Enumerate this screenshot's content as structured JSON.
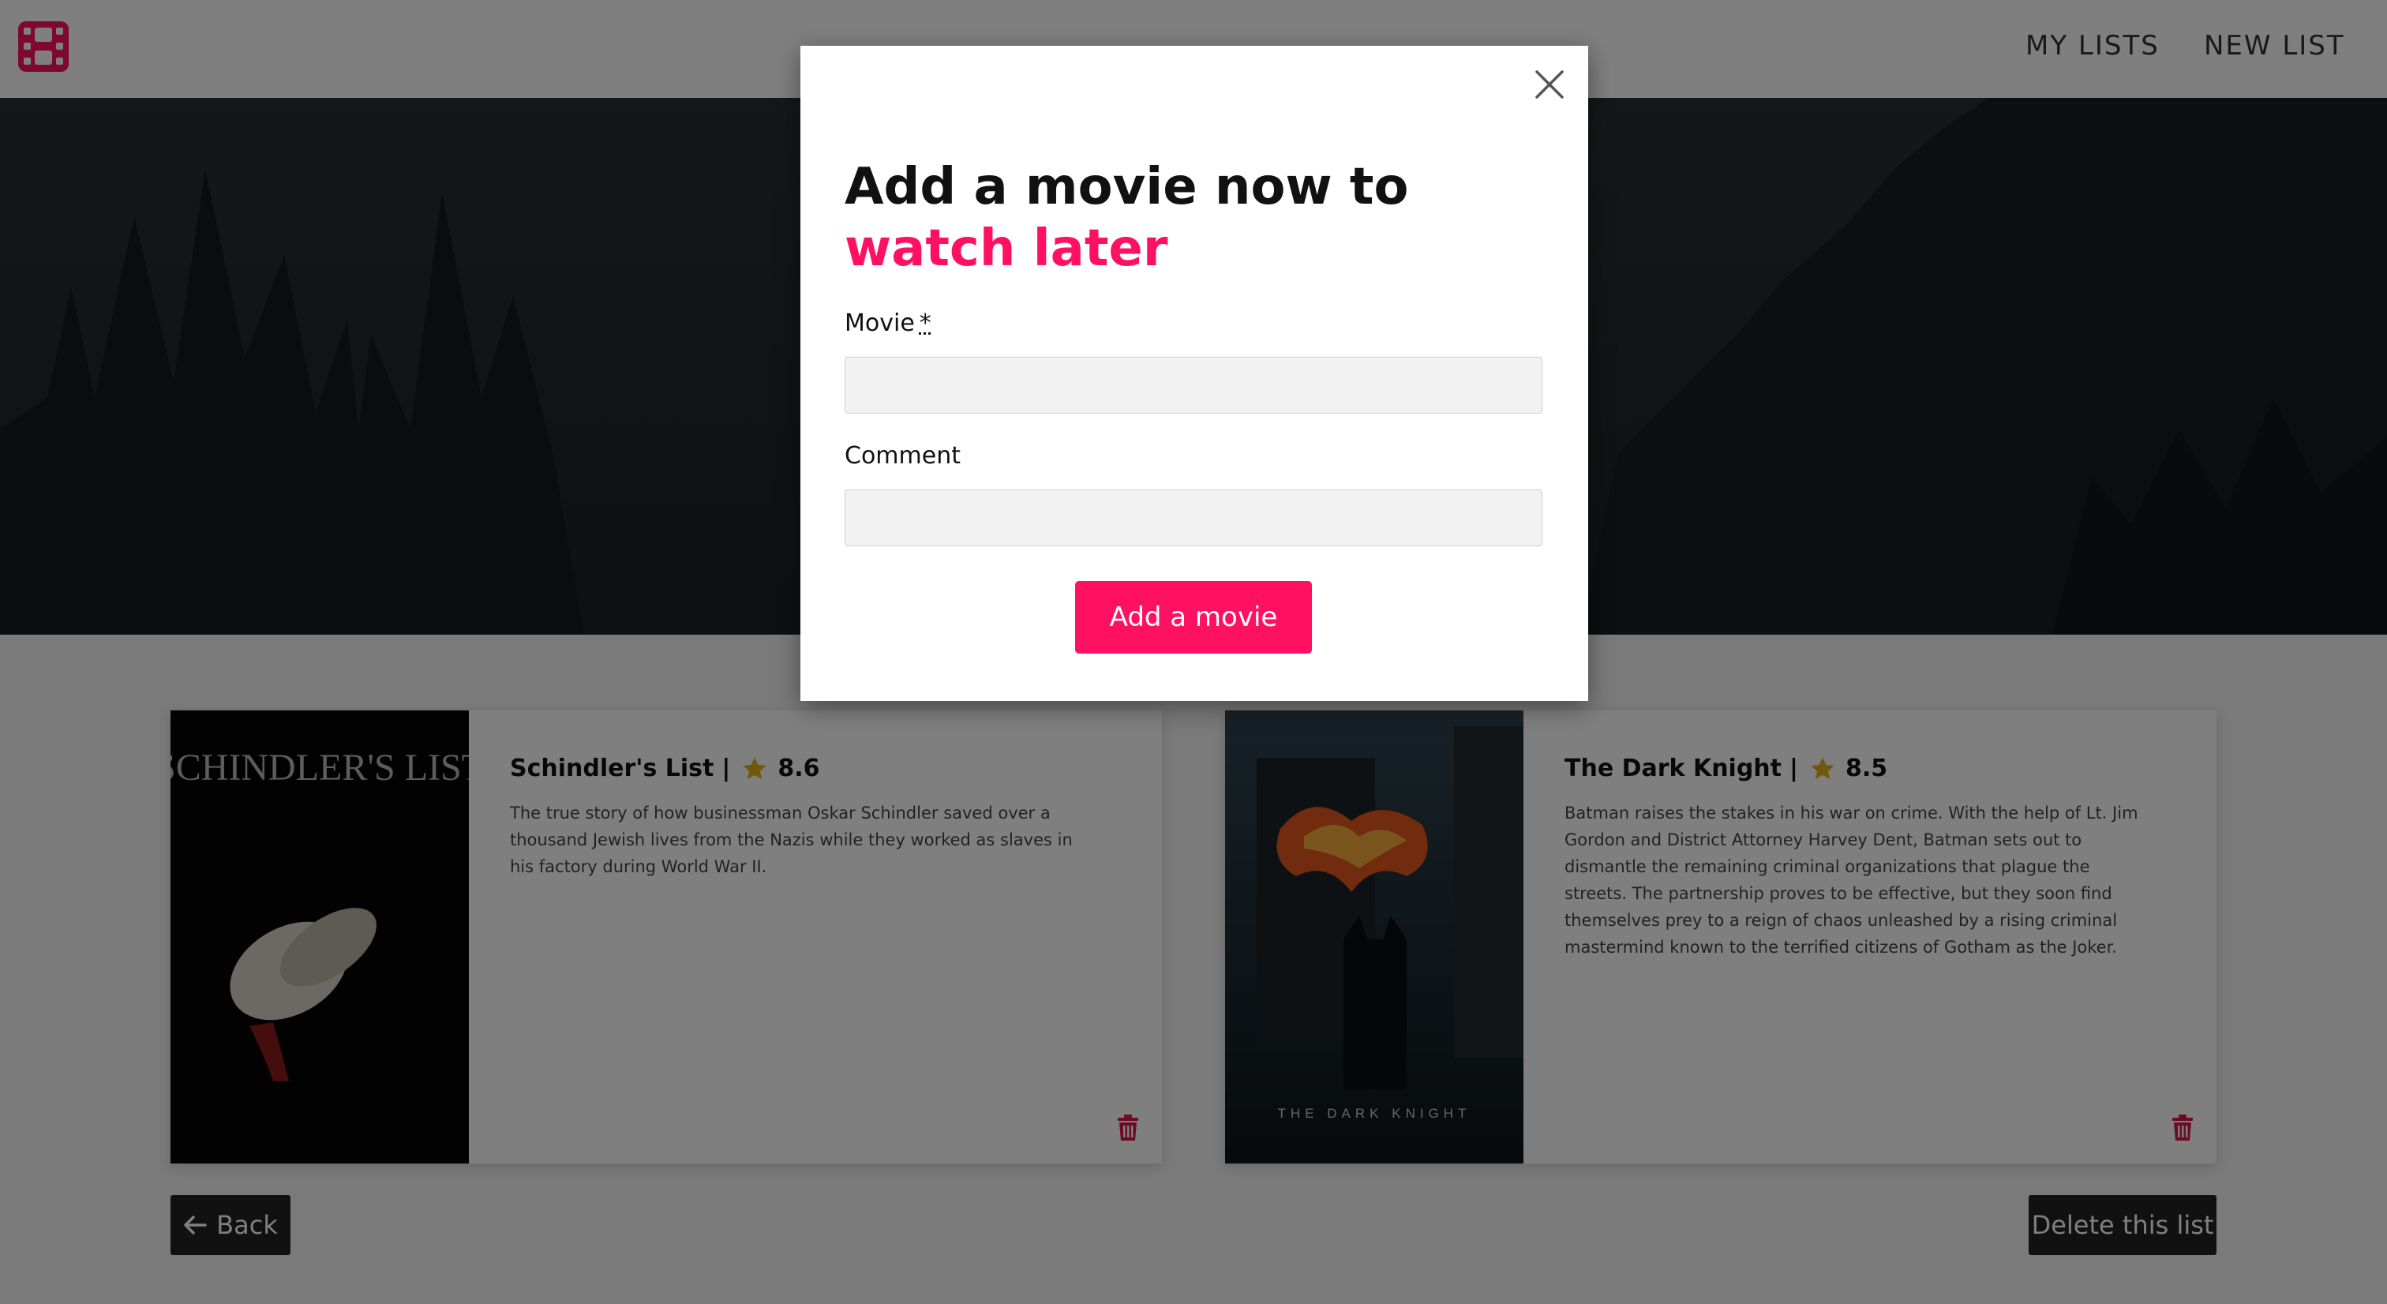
{
  "nav": {
    "logo_icon": "film-icon",
    "links": [
      "MY LISTS",
      "NEW LIST"
    ]
  },
  "colors": {
    "accent": "#ff1060",
    "dark_button": "#222222",
    "star": "#e0b018"
  },
  "movies": [
    {
      "poster_text": "SCHINDLER'S LIST",
      "title": "Schindler's List",
      "separator": "|",
      "rating": "8.6",
      "plot": "The true story of how businessman Oskar Schindler saved over a thousand Jewish lives from the Nazis while they worked as slaves in his factory during World War II."
    },
    {
      "poster_text": "THE DARK KNIGHT",
      "title": "The Dark Knight",
      "separator": "|",
      "rating": "8.5",
      "plot": "Batman raises the stakes in his war on crime. With the help of Lt. Jim Gordon and District Attorney Harvey Dent, Batman sets out to dismantle the remaining criminal organizations that plague the streets. The partnership proves to be effective, but they soon find themselves prey to a reign of chaos unleashed by a rising criminal mastermind known to the terrified citizens of Gotham as the Joker."
    }
  ],
  "actions": {
    "back": "Back",
    "delete_list": "Delete this list"
  },
  "modal": {
    "title_plain": "Add a movie now to ",
    "title_accent": "watch later",
    "movie_label": "Movie",
    "required_mark": "*",
    "movie_value": "",
    "comment_label": "Comment",
    "comment_value": "",
    "submit": "Add a movie"
  }
}
